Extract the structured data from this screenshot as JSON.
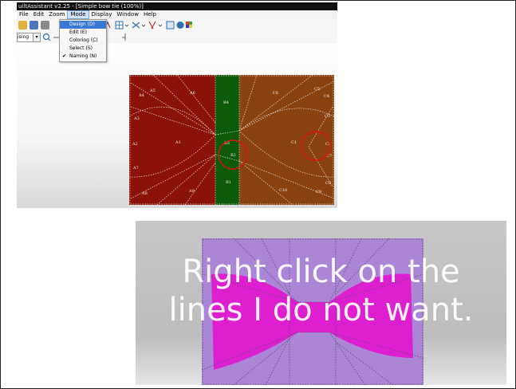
{
  "window": {
    "title": "uiltAssistant v2.25 - [Simple bow tie (100%)]"
  },
  "menubar": {
    "items": [
      "File",
      "Edit",
      "Zoom",
      "Mode",
      "Display",
      "Window",
      "Help"
    ]
  },
  "mode_menu": {
    "items": [
      {
        "label": "Design (D)",
        "highlighted": true,
        "checked": false
      },
      {
        "label": "Edit (E)",
        "highlighted": false,
        "checked": false
      },
      {
        "label": "Coloring (C)",
        "highlighted": false,
        "checked": false
      },
      {
        "label": "Select (S)",
        "highlighted": false,
        "checked": false
      },
      {
        "label": "Naming (N)",
        "highlighted": false,
        "checked": true
      }
    ]
  },
  "toolbar": {
    "combo_value": "ising",
    "icons": [
      "open-icon",
      "save-icon",
      "print-icon",
      "undo-icon",
      "grid-icon",
      "line-icon",
      "scissors-icon",
      "layers-icon",
      "settings-icon",
      "palette-icon",
      "zoom-icon"
    ]
  },
  "design1": {
    "colors": {
      "left": "#8b1206",
      "center": "#0c5a0a",
      "right": "#8a4210",
      "line": "#e8e0d8",
      "highlight_circle": "#e01010"
    },
    "labels": [
      "A5",
      "A4",
      "A6",
      "A3",
      "A2",
      "A1",
      "A7",
      "A8",
      "A9",
      "B4",
      "B3",
      "B2",
      "B1",
      "C6",
      "C5",
      "C4",
      "C3",
      "C1",
      "C2",
      "C7",
      "C8",
      "C10",
      "C9"
    ]
  },
  "design2": {
    "colors": {
      "background": "#ab86d6",
      "bow": "#dd1fd0",
      "line": "#5e4a70"
    }
  },
  "caption": {
    "line1": "Right click on the",
    "line2": "lines I do not want."
  }
}
